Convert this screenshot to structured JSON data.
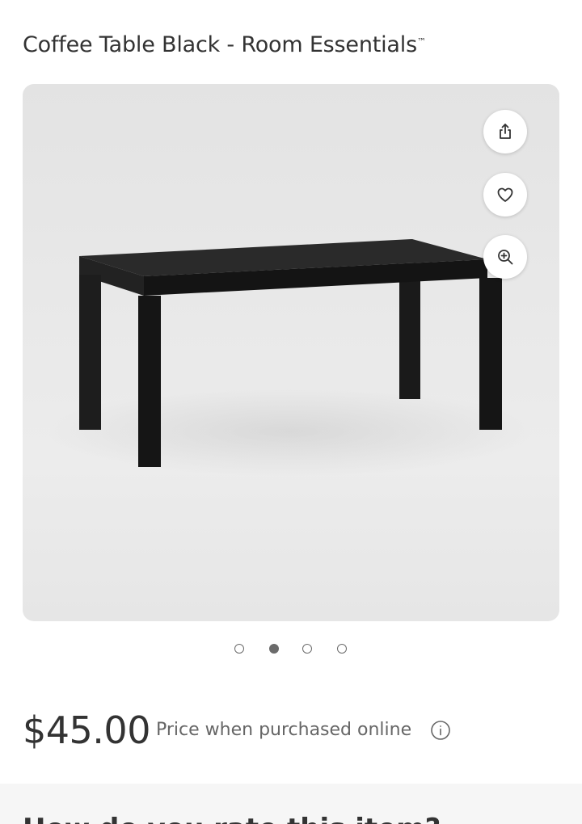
{
  "product": {
    "title": "Coffee Table Black - Room Essentials",
    "trademark": "™"
  },
  "gallery": {
    "image_subject": "black-coffee-table",
    "image_count": 4,
    "active_index": 1,
    "actions": {
      "share_icon": "share-icon",
      "favorite_icon": "heart-icon",
      "zoom_icon": "zoom-in-icon"
    }
  },
  "pricing": {
    "price": "$45.00",
    "note": "Price when purchased online",
    "info_icon": "info-icon"
  },
  "next_section": {
    "heading": "How do you rate this item?"
  },
  "colors": {
    "text": "#333333",
    "muted": "#666666",
    "gallery_bg": "#e8e8e8",
    "table": "#1c1c1c"
  }
}
